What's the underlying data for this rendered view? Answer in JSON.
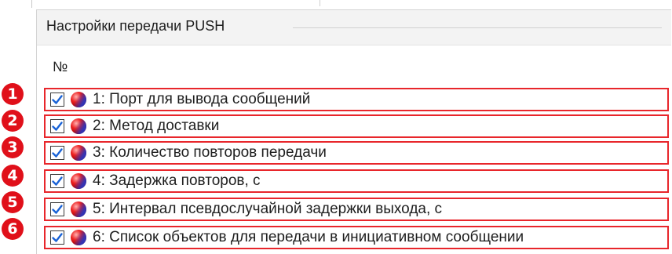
{
  "group": {
    "title": "Настройки передачи PUSH"
  },
  "table": {
    "column_header": "№",
    "rows": [
      {
        "marker": "1",
        "label": "1: Порт для вывода сообщений",
        "checked": true,
        "icon": "red-ball-icon"
      },
      {
        "marker": "2",
        "label": "2: Метод доставки",
        "checked": true,
        "icon": "red-ball-icon"
      },
      {
        "marker": "3",
        "label": "3: Количество повторов передачи",
        "checked": true,
        "icon": "red-ball-icon"
      },
      {
        "marker": "4",
        "label": "4: Задержка повторов, с",
        "checked": true,
        "icon": "red-ball-icon"
      },
      {
        "marker": "5",
        "label": "5: Интервал псевдослучайной задержки выхода, с",
        "checked": true,
        "icon": "red-ball-icon"
      },
      {
        "marker": "6",
        "label": "6: Список объектов для передачи в инициативном сообщении",
        "checked": true,
        "icon": "red-ball-icon"
      }
    ]
  },
  "colors": {
    "highlight_border": "#e8262b",
    "marker_fill": "#e0101a",
    "check_mark": "#1a63d6"
  }
}
